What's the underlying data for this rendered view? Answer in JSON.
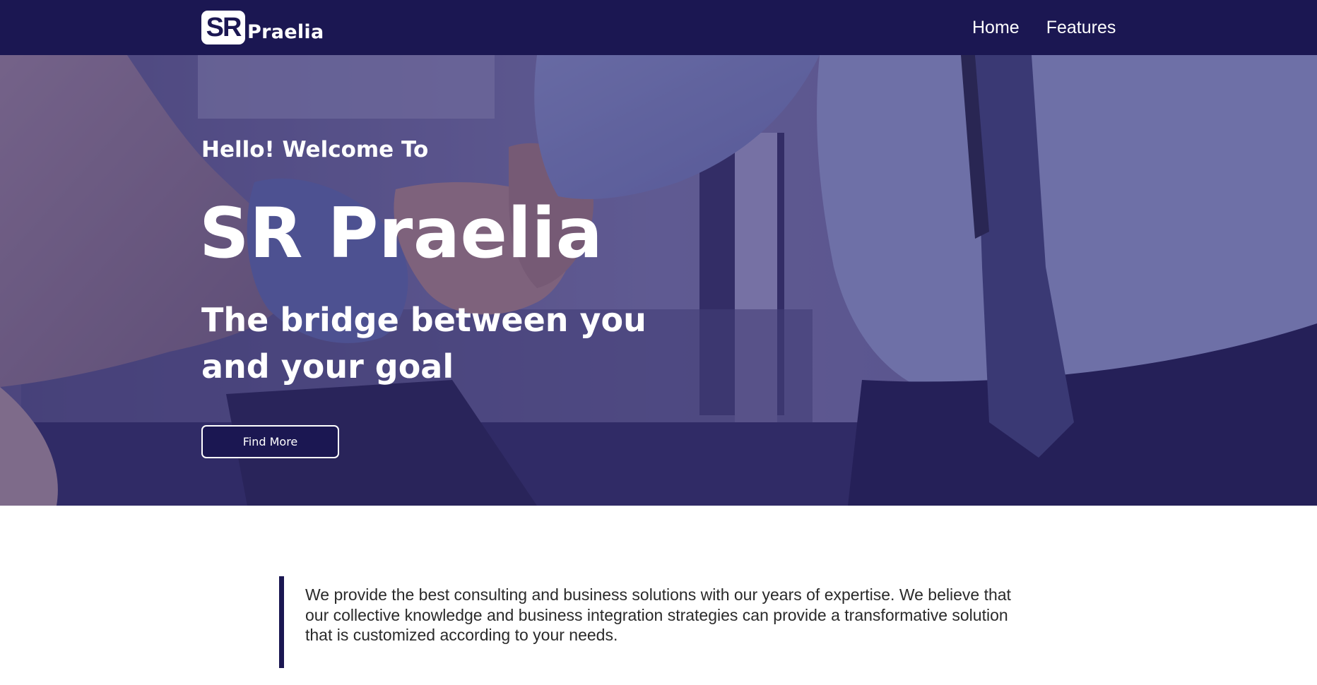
{
  "brand": {
    "logo_mark": "SR",
    "logo_word": "Praelia"
  },
  "nav": {
    "items": [
      {
        "label": "Home"
      },
      {
        "label": "Features"
      }
    ]
  },
  "hero": {
    "greeting": "Hello! Welcome To",
    "title": "SR Praelia",
    "subtitle": "The bridge between you and your goal",
    "button_label": "Find More",
    "background_image": "handshake-photo"
  },
  "intro": {
    "text": "We provide the best consulting and business solutions with our years of expertise. We believe that our collective knowledge and business integration strategies can provide a transformative solution that is customized according to your needs."
  },
  "colors": {
    "brand_navy": "#1b1752",
    "text_dark": "#2a2a2a",
    "white": "#ffffff"
  }
}
